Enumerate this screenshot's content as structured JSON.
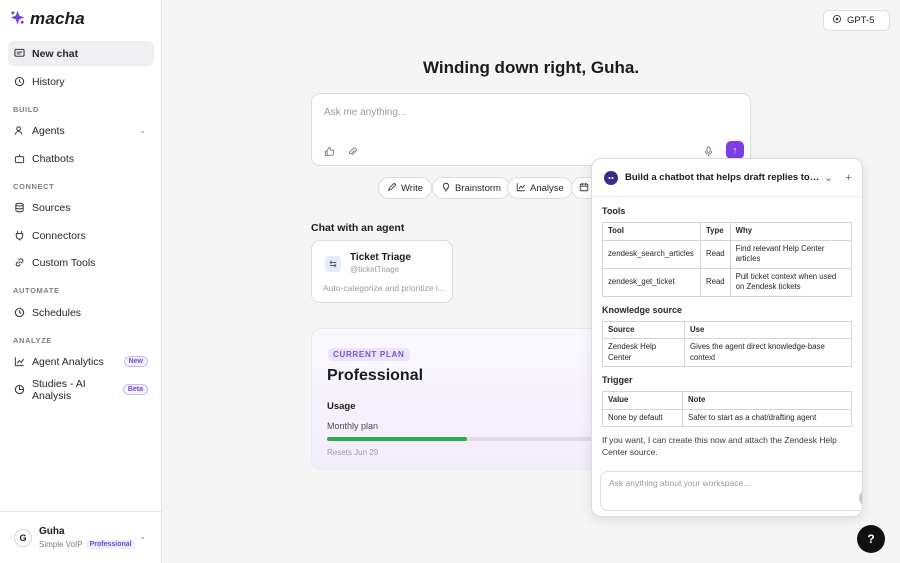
{
  "app": {
    "logo_text": "macha"
  },
  "sidebar": {
    "new_chat": "New chat",
    "history": "History",
    "section_build": "BUILD",
    "agents": "Agents",
    "chatbots": "Chatbots",
    "section_connect": "CONNECT",
    "sources": "Sources",
    "connectors": "Connectors",
    "custom_tools": "Custom Tools",
    "section_automate": "AUTOMATE",
    "schedules": "Schedules",
    "section_analyze": "ANALYZE",
    "agent_analytics": "Agent Analytics",
    "agent_analytics_badge": "New",
    "studies": "Studies - AI Analysis",
    "studies_badge": "Beta",
    "user": {
      "initial": "G",
      "name": "Guha",
      "org": "Simple VoIP",
      "plan": "Professional"
    }
  },
  "header": {
    "model": "GPT-5"
  },
  "main": {
    "greeting": "Winding down right, Guha.",
    "composer_placeholder": "Ask me anything...",
    "chips": [
      "Write",
      "Brainstorm",
      "Analyse"
    ],
    "agents_heading": "Chat with an agent",
    "agent": {
      "name": "Ticket Triage",
      "handle": "@ticketTriage",
      "description": "Auto-categorize and prioritize i..."
    },
    "plan": {
      "label": "CURRENT PLAN",
      "name": "Professional",
      "usage_label": "Usage",
      "monthly_label": "Monthly plan",
      "usage_fraction": 0.49,
      "resets": "Resets Jun 29"
    }
  },
  "chat_panel": {
    "title": "Build a chatbot that helps draft replies to custo...",
    "tools_title": "Tools",
    "tools_headers": [
      "Tool",
      "Type",
      "Why"
    ],
    "tools_rows": [
      [
        "zendesk_search_articles",
        "Read",
        "Find relevant Help Center articles"
      ],
      [
        "zendesk_get_ticket",
        "Read",
        "Pull ticket context when used on Zendesk tickets"
      ]
    ],
    "knowledge_title": "Knowledge source",
    "knowledge_headers": [
      "Source",
      "Use"
    ],
    "knowledge_rows": [
      [
        "Zendesk Help Center",
        "Gives the agent direct knowledge-base context"
      ]
    ],
    "trigger_title": "Trigger",
    "trigger_headers": [
      "Value",
      "Note"
    ],
    "trigger_rows": [
      [
        "None by default",
        "Safer to start as a chat/drafting agent"
      ]
    ],
    "note": "If you want, I can create this now and attach the Zendesk Help Center source.",
    "input_placeholder": "Ask anything about your workspace..."
  },
  "help": {
    "label": "?"
  },
  "colors": {
    "accent": "#7b3fe4",
    "progress": "#2faa4f",
    "dark": "#111114"
  }
}
